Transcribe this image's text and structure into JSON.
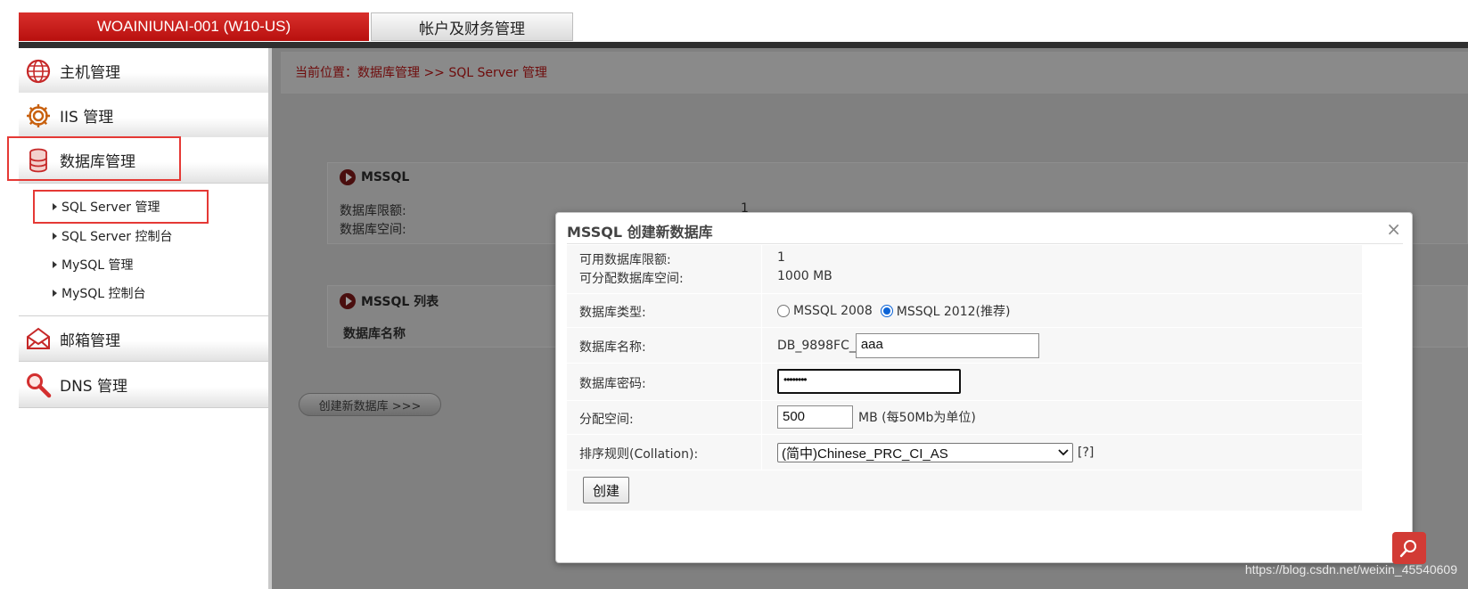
{
  "tabs": {
    "active": "WOAINIUNAI-001 (W10-US)",
    "second": "帐户及财务管理"
  },
  "sidebar": {
    "items": [
      {
        "label": "主机管理",
        "icon": "globe-icon"
      },
      {
        "label": "IIS 管理",
        "icon": "gear-icon"
      },
      {
        "label": "数据库管理",
        "icon": "database-icon"
      },
      {
        "label": "邮箱管理",
        "icon": "envelope-icon"
      },
      {
        "label": "DNS 管理",
        "icon": "search-icon"
      }
    ],
    "subitems": [
      "SQL Server 管理",
      "SQL Server 控制台",
      "MySQL 管理",
      "MySQL 控制台"
    ]
  },
  "breadcrumb": "当前位置：数据库管理 >> SQL Server 管理",
  "background": {
    "mssql_title": "MSSQL",
    "quota_label": "数据库限额:",
    "quota_value": "1",
    "space_label": "数据库空间:",
    "list_title": "MSSQL 列表",
    "list_col": "数据库名称",
    "create_button": "创建新数据库 >>>"
  },
  "modal": {
    "title": "MSSQL 创建新数据库",
    "close": "×",
    "available_quota_label": "可用数据库限额:",
    "available_quota_value": "1",
    "allocatable_space_label": "可分配数据库空间:",
    "allocatable_space_value": "1000 MB",
    "type_label": "数据库类型:",
    "type_options": [
      "MSSQL 2008",
      "MSSQL 2012(推荐)"
    ],
    "type_selected": "MSSQL 2012(推荐)",
    "name_label": "数据库名称:",
    "name_prefix": "DB_9898FC_",
    "name_value": "aaa",
    "password_label": "数据库密码:",
    "password_value": "••••••••",
    "size_label": "分配空间:",
    "size_value": "500",
    "size_unit": "MB (每50Mb为单位)",
    "collation_label": "排序规则(Collation):",
    "collation_value": "(简中)Chinese_PRC_CI_AS",
    "collation_help": "[?]",
    "submit": "创建"
  },
  "watermark": "https://blog.csdn.net/weixin_45540609",
  "colors": {
    "accent": "#c81e1e",
    "overlay": "#808080"
  }
}
